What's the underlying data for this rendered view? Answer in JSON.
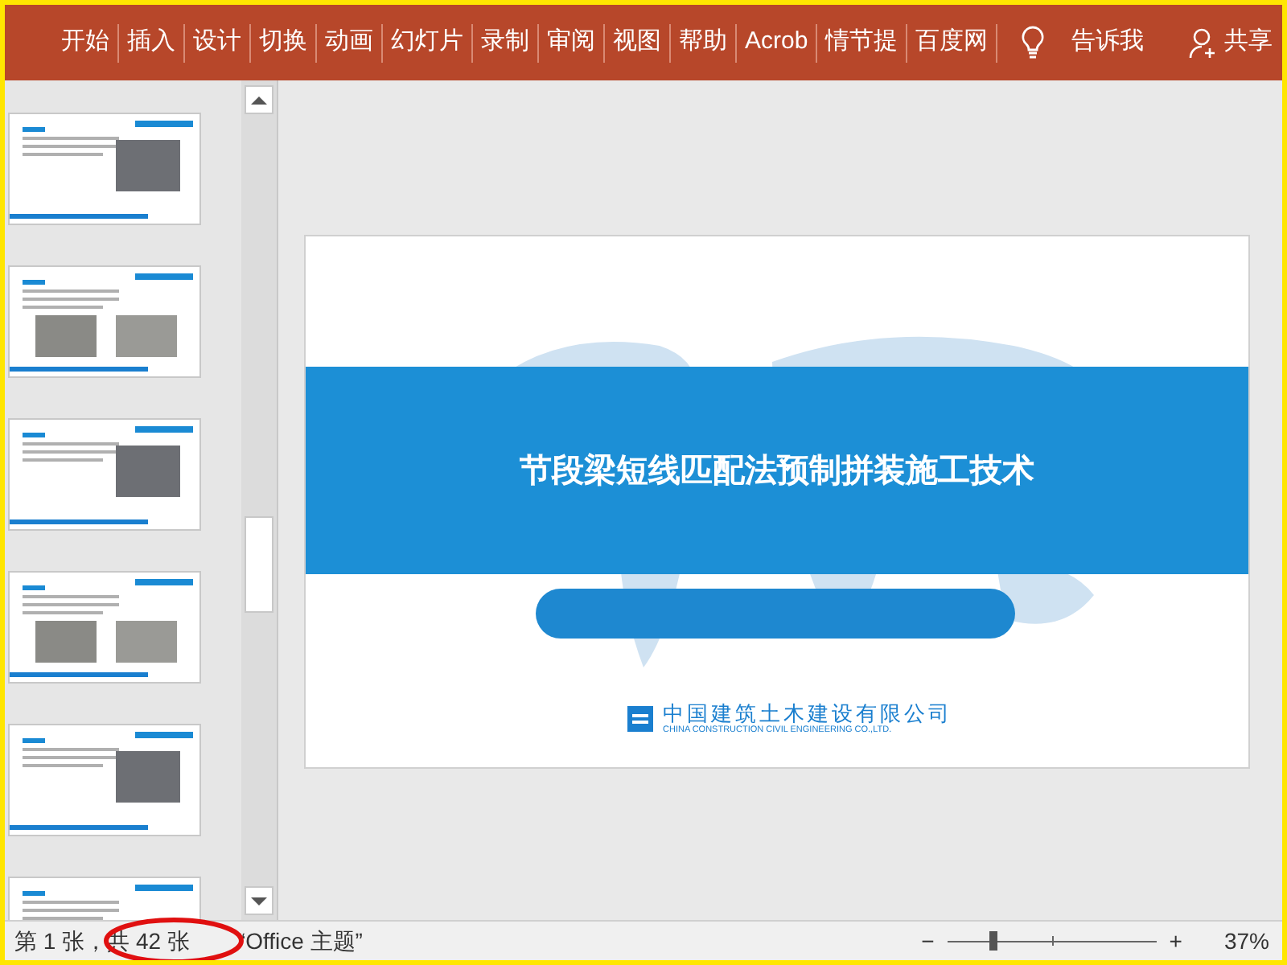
{
  "ribbon": {
    "tabs": [
      {
        "label": "开始"
      },
      {
        "label": "插入"
      },
      {
        "label": "设计"
      },
      {
        "label": "切换"
      },
      {
        "label": "动画"
      },
      {
        "label": "幻灯片"
      },
      {
        "label": "录制"
      },
      {
        "label": "审阅"
      },
      {
        "label": "视图"
      },
      {
        "label": "帮助"
      },
      {
        "label": "Acrob"
      },
      {
        "label": "情节提"
      },
      {
        "label": "百度网"
      }
    ],
    "tell_me": "告诉我",
    "share": "共享"
  },
  "slide": {
    "title": "节段梁短线匹配法预制拼装施工技术",
    "company_cn": "中国建筑土木建设有限公司",
    "company_en": "CHINA CONSTRUCTION CIVIL ENGINEERING CO.,LTD."
  },
  "status_bar": {
    "slide_info": "第 1 张，共 42 张",
    "theme": "“Office 主题”",
    "zoom_out": "−",
    "zoom_in": "+",
    "zoom": {
      "level": 0.22
    },
    "zoom_reading": "37%"
  }
}
